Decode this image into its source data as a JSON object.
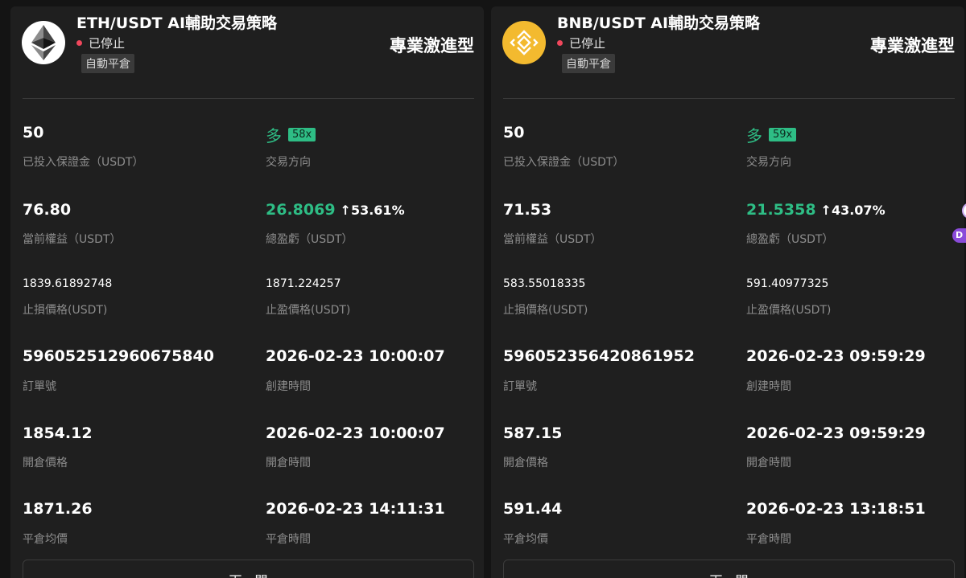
{
  "colors": {
    "background": "#141414",
    "card": "#1f1f1f",
    "accent_green": "#2ebd85",
    "status_red": "#f0475c",
    "label_gray": "#8c8c8c",
    "eth_icon_bg": "#ffffff",
    "bnb_icon_bg": "#f3ba2f"
  },
  "cards": [
    {
      "icon": "ethereum-icon",
      "title": "ETH/USDT AI輔助交易策略",
      "status": "已停止",
      "tag": "自動平倉",
      "risk": "專業激進型",
      "margin": {
        "value": "50",
        "label": "已投入保證金（USDT）"
      },
      "direction": {
        "value": "多",
        "leverage": "58x",
        "label": "交易方向"
      },
      "equity": {
        "value": "76.80",
        "label": "當前權益（USDT）"
      },
      "pnl": {
        "value": "26.8069",
        "pct": "↑53.61%",
        "label": "總盈虧（USDT）"
      },
      "stop_loss": {
        "value": "1839.61892748",
        "label": "止損價格(USDT)"
      },
      "take_profit": {
        "value": "1871.224257",
        "label": "止盈價格(USDT)"
      },
      "order_no": {
        "value": "596052512960675840",
        "label": "訂單號"
      },
      "created": {
        "value": "2026-02-23 10:00:07",
        "label": "創建時間"
      },
      "open_price": {
        "value": "1854.12",
        "label": "開倉價格"
      },
      "open_time": {
        "value": "2026-02-23 10:00:07",
        "label": "開倉時間"
      },
      "close_price": {
        "value": "1871.26",
        "label": "平倉均價"
      },
      "close_time": {
        "value": "2026-02-23 14:11:31",
        "label": "平倉時間"
      },
      "button": "下一開"
    },
    {
      "icon": "bnb-icon",
      "title": "BNB/USDT AI輔助交易策略",
      "status": "已停止",
      "tag": "自動平倉",
      "risk": "專業激進型",
      "margin": {
        "value": "50",
        "label": "已投入保證金（USDT）"
      },
      "direction": {
        "value": "多",
        "leverage": "59x",
        "label": "交易方向"
      },
      "equity": {
        "value": "71.53",
        "label": "當前權益（USDT）"
      },
      "pnl": {
        "value": "21.5358",
        "pct": "↑43.07%",
        "label": "總盈虧（USDT）"
      },
      "stop_loss": {
        "value": "583.55018335",
        "label": "止損價格(USDT)"
      },
      "take_profit": {
        "value": "591.40977325",
        "label": "止盈價格(USDT)"
      },
      "order_no": {
        "value": "596052356420861952",
        "label": "訂單號"
      },
      "created": {
        "value": "2026-02-23 09:59:29",
        "label": "創建時間"
      },
      "open_price": {
        "value": "587.15",
        "label": "開倉價格"
      },
      "open_time": {
        "value": "2026-02-23 09:59:29",
        "label": "開倉時間"
      },
      "close_price": {
        "value": "591.44",
        "label": "平倉均價"
      },
      "close_time": {
        "value": "2026-02-23 13:18:51",
        "label": "平倉時間"
      },
      "button": "下一開"
    }
  ],
  "edge_badge": "D"
}
